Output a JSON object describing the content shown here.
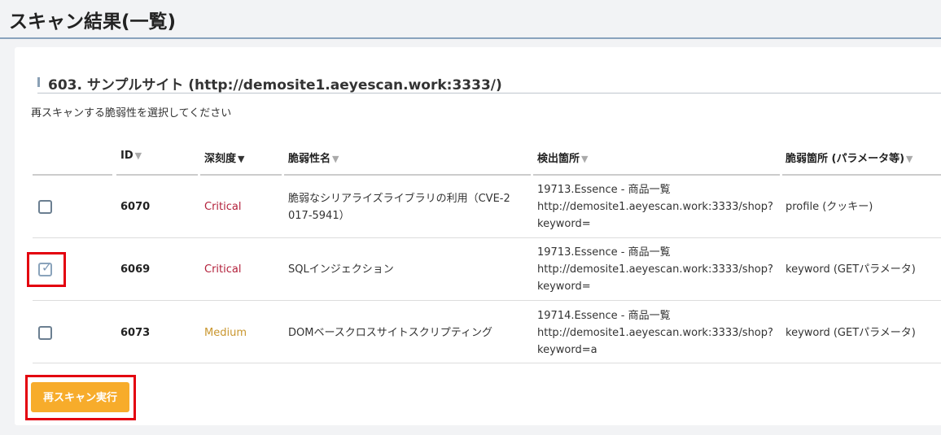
{
  "page": {
    "title": "スキャン結果(一覧)"
  },
  "panel": {
    "site_title": "603. サンプルサイト (http://demosite1.aeyescan.work:3333/)",
    "instruction": "再スキャンする脆弱性を選択してください"
  },
  "table": {
    "headers": [
      {
        "label": "ID",
        "sort": "▼"
      },
      {
        "label": "深刻度",
        "sort": "▼"
      },
      {
        "label": "脆弱性名",
        "sort": "▼"
      },
      {
        "label": "検出箇所",
        "sort": "▼"
      },
      {
        "label": "脆弱箇所 (パラメータ等)",
        "sort": "▼"
      }
    ],
    "rows": [
      {
        "checked": false,
        "id": "6070",
        "severity": "Critical",
        "name_line1": "脆弱なシリアライズライブラリの利用（CVE-2",
        "name_line2": "017-5941）",
        "loc_line1": "19713.Essence - 商品一覧",
        "loc_line2": "http://demosite1.aeyescan.work:3333/shop?",
        "loc_line3": "keyword=",
        "param": "profile (クッキー)"
      },
      {
        "checked": true,
        "id": "6069",
        "severity": "Critical",
        "name_line1": "SQLインジェクション",
        "loc_line1": "19713.Essence - 商品一覧",
        "loc_line2": "http://demosite1.aeyescan.work:3333/shop?",
        "loc_line3": "keyword=",
        "param": "keyword (GETパラメータ)"
      },
      {
        "checked": false,
        "id": "6073",
        "severity": "Medium",
        "name_line1": "DOMベースクロスサイトスクリプティング",
        "loc_line1": "19714.Essence - 商品一覧",
        "loc_line2": "http://demosite1.aeyescan.work:3333/shop?",
        "loc_line3": "keyword=a",
        "param": "keyword (GETパラメータ)"
      }
    ]
  },
  "actions": {
    "rescan_label": "再スキャン実行"
  },
  "colors": {
    "critical": "#b3213b",
    "medium": "#c9962e",
    "button": "#f7ac2b",
    "highlight": "#e3000f"
  }
}
